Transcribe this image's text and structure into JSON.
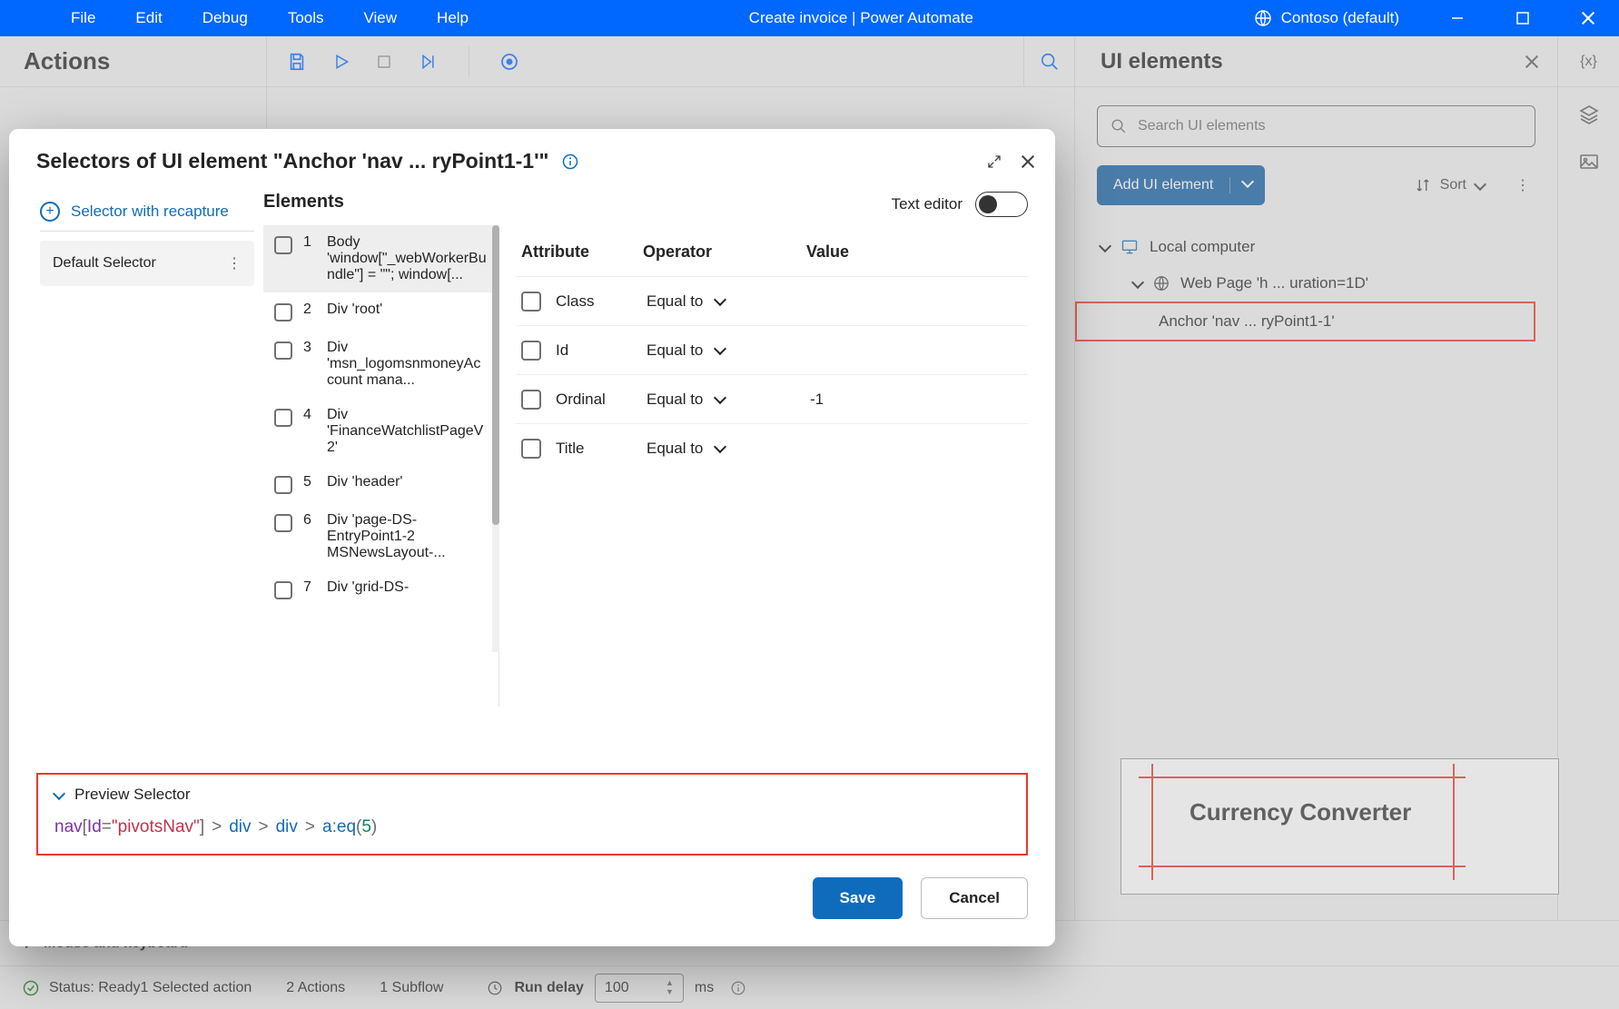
{
  "titlebar": {
    "menus": [
      "File",
      "Edit",
      "Debug",
      "Tools",
      "View",
      "Help"
    ],
    "center": "Create invoice | Power Automate",
    "org": "Contoso (default)"
  },
  "header": {
    "actions_title": "Actions",
    "ui_elements_title": "UI elements"
  },
  "ui_elements": {
    "search_placeholder": "Search UI elements",
    "add_button": "Add UI element",
    "sort_label": "Sort",
    "tree": {
      "root": "Local computer",
      "page": "Web Page 'h ... uration=1D'",
      "leaf": "Anchor 'nav ... ryPoint1-1'"
    },
    "preview_label": "Currency Converter"
  },
  "actions_row": {
    "label": "Mouse and keyboard"
  },
  "dialog": {
    "title": "Selectors of UI element \"Anchor 'nav ... ryPoint1-1'\"",
    "recapture": "Selector with recapture",
    "default_selector": "Default Selector",
    "elements_title": "Elements",
    "text_editor": "Text editor",
    "elements": [
      {
        "n": "1",
        "txt": "Body 'window[\"_webWorkerBundle\"] = \"\"; window[..."
      },
      {
        "n": "2",
        "txt": "Div 'root'"
      },
      {
        "n": "3",
        "txt": "Div 'msn_logomsnmoneyAccount mana..."
      },
      {
        "n": "4",
        "txt": "Div 'FinanceWatchlistPageV2'"
      },
      {
        "n": "5",
        "txt": "Div 'header'"
      },
      {
        "n": "6",
        "txt": "Div 'page-DS-EntryPoint1-2 MSNewsLayout-..."
      },
      {
        "n": "7",
        "txt": "Div 'grid-DS-"
      }
    ],
    "attr_head": {
      "a": "Attribute",
      "o": "Operator",
      "v": "Value"
    },
    "attrs": [
      {
        "name": "Class",
        "op": "Equal to",
        "val": ""
      },
      {
        "name": "Id",
        "op": "Equal to",
        "val": ""
      },
      {
        "name": "Ordinal",
        "op": "Equal to",
        "val": "-1"
      },
      {
        "name": "Title",
        "op": "Equal to",
        "val": ""
      }
    ],
    "preview_label": "Preview Selector",
    "selector": {
      "p1": "nav",
      "p2": "Id",
      "p3": "=",
      "p4": "\"pivotsNav\"",
      "p5": "div",
      "p6": "div",
      "p7": "a",
      "p8": "eq",
      "p9": "5"
    },
    "save": "Save",
    "cancel": "Cancel"
  },
  "status": {
    "ready": "Status: Ready",
    "selected": "1 Selected action",
    "actions": "2 Actions",
    "subflow": "1 Subflow",
    "run_delay": "Run delay",
    "delay_val": "100",
    "ms": "ms"
  }
}
